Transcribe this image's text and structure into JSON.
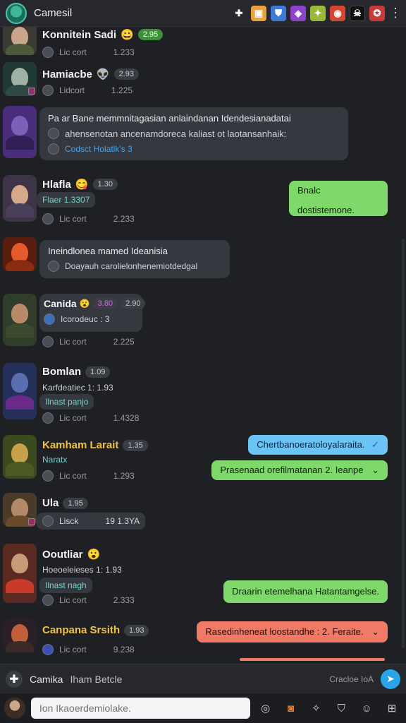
{
  "header": {
    "title": "Camesil",
    "icons": [
      {
        "name": "cross-icon",
        "glyph": "✚",
        "color": "#ffffff"
      },
      {
        "name": "game-icon",
        "glyph": "▣",
        "color": "#e8a33a"
      },
      {
        "name": "shield-icon",
        "glyph": "⛊",
        "color": "#3d7ad6"
      },
      {
        "name": "spell-icon",
        "glyph": "◈",
        "color": "#8e44c8"
      },
      {
        "name": "leaf-icon",
        "glyph": "✦",
        "color": "#9ab83a"
      },
      {
        "name": "target-icon",
        "glyph": "◉",
        "color": "#d6452f"
      },
      {
        "name": "skull-icon",
        "glyph": "☠",
        "color": "#222222"
      },
      {
        "name": "gift-icon",
        "glyph": "✪",
        "color": "#c83a3a"
      }
    ]
  },
  "messages": [
    {
      "name": "Konnitein Sadi",
      "emoji": "😀",
      "pill": "2.95",
      "meta": "Lic cort",
      "time": "1.233"
    },
    {
      "name": "Hamiacbe",
      "emoji": "👽",
      "pill": "2.93",
      "meta": "Lidcort",
      "time": "1.225"
    },
    {
      "text1": "Pa ar Bane memmnitagasian anlaindanan Idendesianadatai",
      "text2": "ahensenotan ancenamdoreca kaliast ot laotansanhaik:",
      "text3": "Codsct Holatlk's 3"
    },
    {
      "name": "Hlafla",
      "emoji": "😋",
      "pill": "1.30",
      "sub": "Flaer 1.3307",
      "meta": "Lic cort",
      "time": "2.233"
    },
    {
      "text1": "Ineindlonea mamed Ideanisia",
      "text2": "Doayauh carolielonhenemiotdedgal"
    },
    {
      "name": "Canida",
      "emoji": "😮",
      "pill": "2.90",
      "pill2": "3.80",
      "sub": "Icorodeuc : 3",
      "meta": "Lic cort",
      "time": "2.225"
    },
    {
      "name": "Bomlan",
      "pill": "1.09",
      "sub": "Karfdeatiec 1: 1.93",
      "sub2": "Ilnast panjo",
      "meta": "Lic cort",
      "time": "1.4328"
    },
    {
      "name": "Kamham Larait",
      "pill": "1.35",
      "sub": "Naratx",
      "meta": "Lic cort",
      "time": "1.293"
    },
    {
      "name": "Ula",
      "pill": "1.95",
      "sub": "Lisck",
      "time": "19 1.3YA"
    },
    {
      "name": "Ooutliar",
      "emoji": "😮",
      "sub": "Hoeoeleieses 1: 1.93",
      "sub2": "Ilnast nagh",
      "meta": "Lic cort",
      "time": "2.333"
    },
    {
      "name": "Canpana Srsith",
      "pill": "1.93",
      "meta": "Lic cort",
      "time": "9.238"
    }
  ],
  "replies": [
    {
      "text": "Bnalc dostistemone."
    },
    {
      "text": "Chertbanoeratoloyalaraita."
    },
    {
      "text": "Prasenaad orefilmatanan 2. Ieanpe"
    },
    {
      "text": "Draarin etemelhana Hatantamgelse."
    },
    {
      "text": "Rasedinheneat loostandhe : 2. Feraite."
    }
  ],
  "reply_bar": {
    "label": "Camika",
    "sub": "Iham Betcle",
    "right": "Cracloe IoA"
  },
  "composer": {
    "placeholder": "Ion Ikaoerdemiolake."
  },
  "colors": {
    "green": "#7ed86a",
    "blue": "#6cc3f5",
    "red": "#f07a66",
    "send": "#2aa4e8"
  }
}
